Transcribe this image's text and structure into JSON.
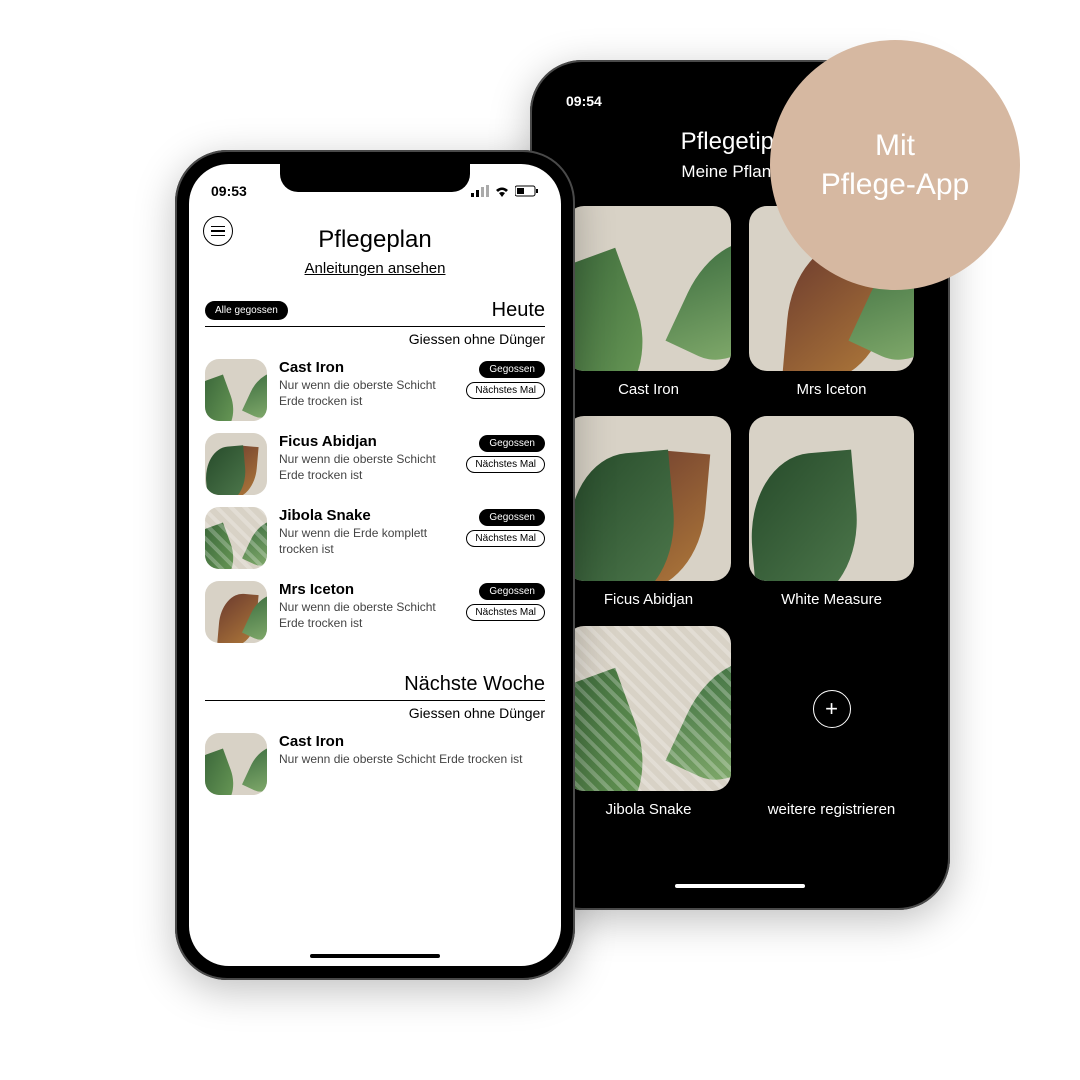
{
  "badge": {
    "line1": "Mit",
    "line2": "Pflege-App"
  },
  "back": {
    "time": "09:54",
    "title": "Pflegetipps",
    "subtitle": "Meine Pflanzen",
    "tiles": [
      {
        "label": "Cast Iron"
      },
      {
        "label": "Mrs Iceton"
      },
      {
        "label": "Ficus Abidjan"
      },
      {
        "label": "White Measure"
      },
      {
        "label": "Jibola Snake"
      }
    ],
    "add_label": "weitere registrieren"
  },
  "front": {
    "time": "09:53",
    "title": "Pflegeplan",
    "link": "Anleitungen ansehen",
    "all_label": "Alle gegossen",
    "today_title": "Heute",
    "today_sub": "Giessen ohne Dünger",
    "btn_done": "Gegossen",
    "btn_next": "Nächstes Mal",
    "next_title": "Nächste Woche",
    "next_sub": "Giessen ohne Dünger",
    "items": [
      {
        "name": "Cast Iron",
        "desc": "Nur wenn die oberste Schicht Erde trocken ist"
      },
      {
        "name": "Ficus Abidjan",
        "desc": "Nur wenn die oberste Schicht Erde trocken ist"
      },
      {
        "name": "Jibola Snake",
        "desc": "Nur wenn die Erde komplett trocken ist"
      },
      {
        "name": "Mrs Iceton",
        "desc": "Nur wenn die oberste Schicht Erde trocken ist"
      }
    ],
    "next_items": [
      {
        "name": "Cast Iron",
        "desc": "Nur wenn die oberste Schicht Erde trocken ist"
      }
    ]
  }
}
